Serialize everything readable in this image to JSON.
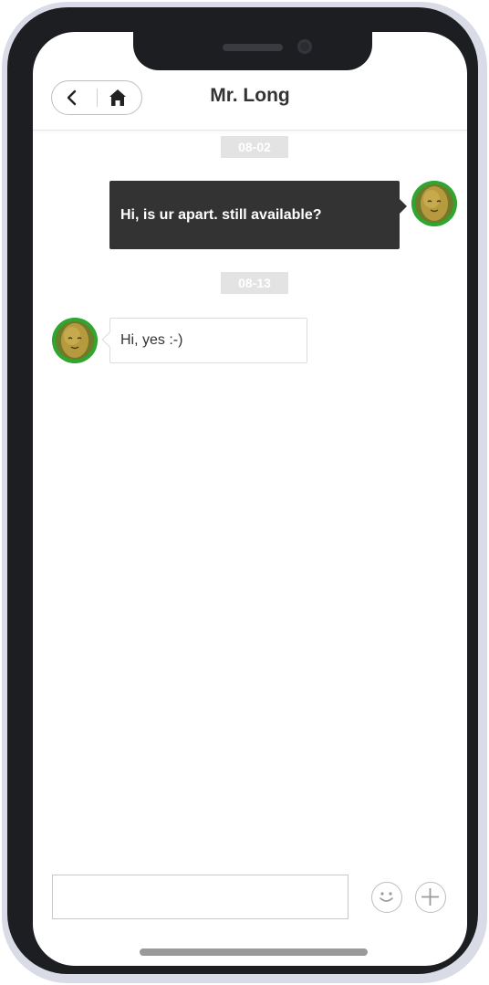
{
  "header": {
    "title": "Mr. Long",
    "back_icon": "chevron-left-icon",
    "home_icon": "home-icon"
  },
  "messages": [
    {
      "date": "08-02",
      "direction": "outgoing",
      "text": "Hi, is ur apart. still available?"
    },
    {
      "date": "08-13",
      "direction": "incoming",
      "text": "Hi, yes :-)"
    }
  ],
  "composer": {
    "value": "",
    "placeholder": "",
    "emoji_icon": "smiley-icon",
    "add_icon": "plus-icon"
  },
  "colors": {
    "outgoing_bubble": "#333333",
    "avatar_ring": "#2fa62f",
    "date_badge": "#e3e3e3"
  }
}
